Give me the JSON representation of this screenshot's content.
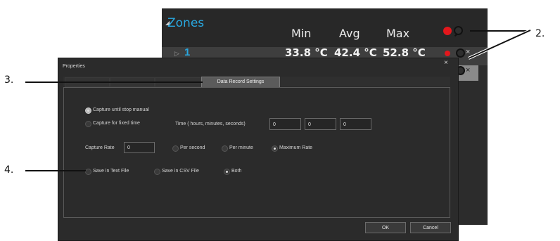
{
  "zones": {
    "title": "Zones",
    "columns": [
      "Min",
      "Avg",
      "Max"
    ],
    "row": {
      "index": "1",
      "min": "33.8 °C",
      "avg": "42.4 °C",
      "max": "52.8 °C"
    },
    "close_glyph": "×",
    "collapse_glyph": "◢",
    "expand_glyph": "▷"
  },
  "dialog": {
    "title": "Properties",
    "close_glyph": "×",
    "active_tab": "Data Record Settings",
    "capture_until_stop": "Capture until stop manual",
    "capture_fixed_time": "Capture for fixed time",
    "time_label": "Time ( hours, minutes, seconds)",
    "time_hours": "0",
    "time_minutes": "0",
    "time_seconds": "0",
    "capture_rate_label": "Capture Rate",
    "capture_rate_value": "0",
    "per_second": "Per second",
    "per_minute": "Per minute",
    "maximum_rate": "Maximum Rate",
    "save_text": "Save in Text File",
    "save_csv": "Save in CSV File",
    "save_both": "Both",
    "ok": "OK",
    "cancel": "Cancel"
  },
  "callouts": {
    "c2": "2.",
    "c3": "3.",
    "c4": "4."
  },
  "colors": {
    "accent_blue": "#29a8e0",
    "record_red": "#e3171c",
    "panel_dark": "#2c2c2c"
  }
}
